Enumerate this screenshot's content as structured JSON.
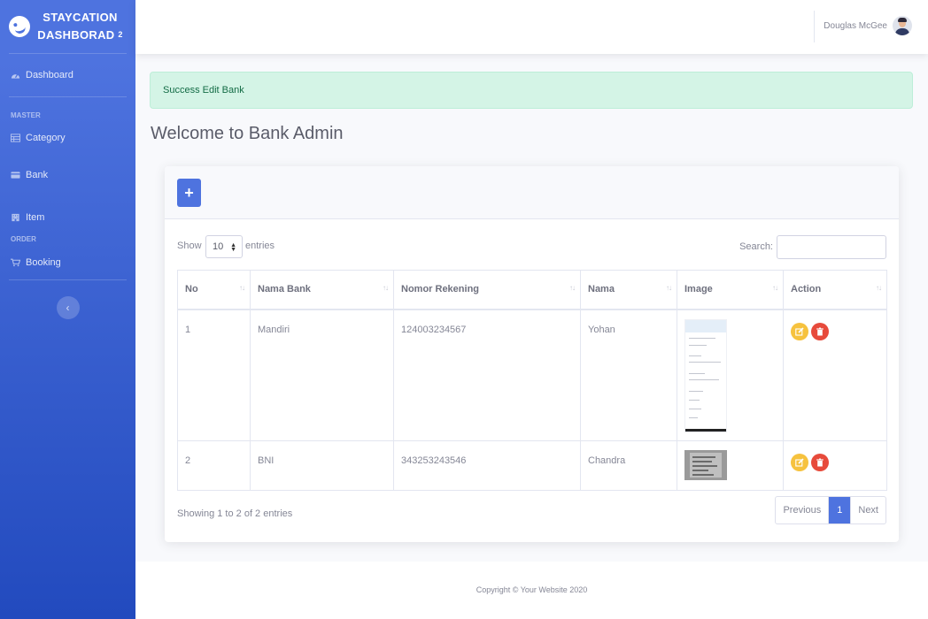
{
  "brand": {
    "line1": "STAYCATION",
    "line2": "DASHBORAD",
    "sup": "2"
  },
  "sidebar": {
    "dashboard": "Dashboard",
    "heading_master": "MASTER",
    "category": "Category",
    "bank": "Bank",
    "item": "Item",
    "heading_order": "ORDER",
    "booking": "Booking",
    "toggle": "‹"
  },
  "topbar": {
    "user_name": "Douglas McGee"
  },
  "alert": {
    "message": "Success Edit Bank"
  },
  "page": {
    "title": "Welcome to Bank Admin"
  },
  "toolbar": {
    "add_label": "+"
  },
  "datatable": {
    "show_label": "Show",
    "page_length": "10",
    "entries_label": "entries",
    "search_label": "Search:",
    "search_value": "",
    "columns": [
      "No",
      "Nama Bank",
      "Nomor Rekening",
      "Nama",
      "Image",
      "Action"
    ],
    "rows": [
      {
        "no": "1",
        "bank": "Mandiri",
        "account": "124003234567",
        "name": "Yohan"
      },
      {
        "no": "2",
        "bank": "BNI",
        "account": "343253243546",
        "name": "Chandra"
      }
    ],
    "info": "Showing 1 to 2 of 2 entries",
    "pagination": {
      "previous": "Previous",
      "current": "1",
      "next": "Next"
    }
  },
  "footer": {
    "copyright": "Copyright © Your Website 2020"
  },
  "colors": {
    "primary": "#4e73df",
    "success_bg": "#d4f4e6",
    "warning": "#f6c23e",
    "danger": "#e74a3b"
  }
}
